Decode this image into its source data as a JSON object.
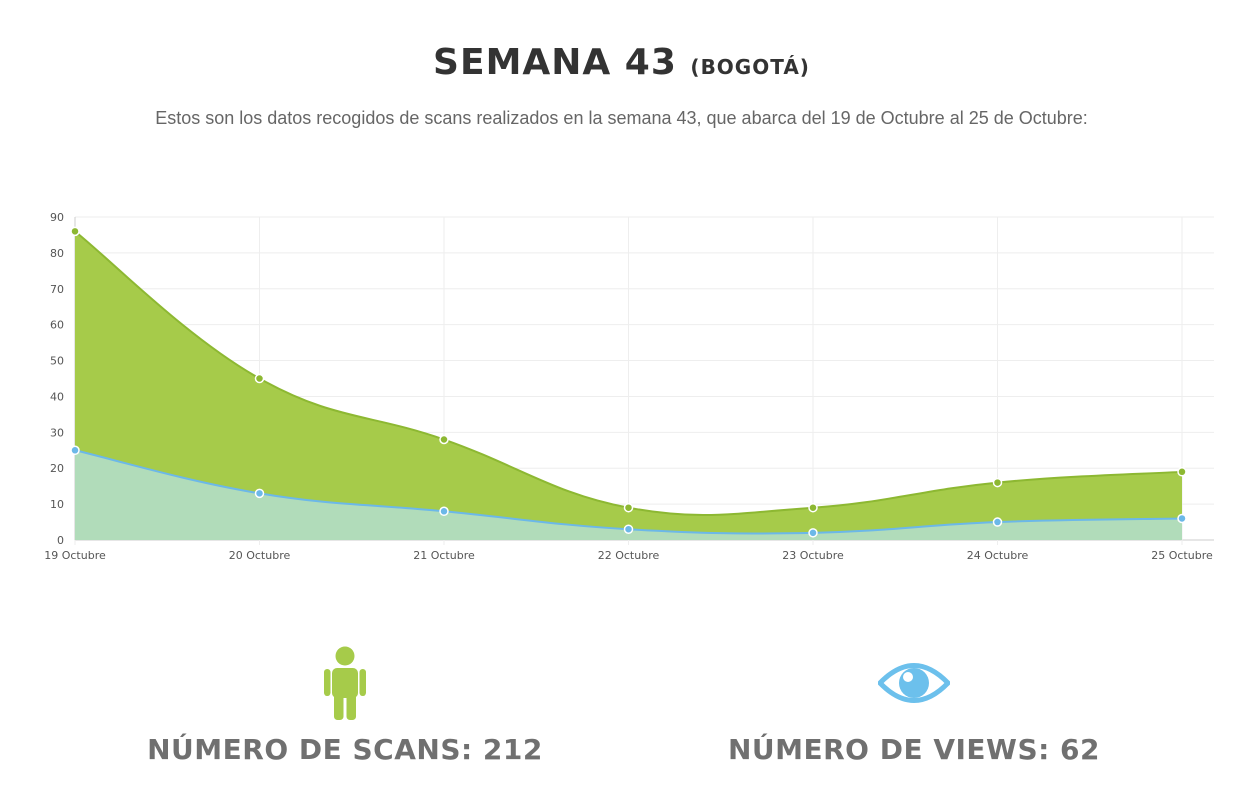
{
  "header": {
    "title_main": "SEMANA 43",
    "title_city": "(BOGOTÁ)",
    "subtitle": "Estos son los datos recogidos de scans realizados en la semana 43, que abarca del 19 de Octubre al 25 de Octubre:"
  },
  "colors": {
    "scans_fill": "#a6cb4a",
    "scans_line": "#8db832",
    "views_fill": "#b1dcba",
    "views_line": "#6cb8e8",
    "views_point": "#6cb8e8",
    "grid": "#eeeeee",
    "axis": "#cccccc"
  },
  "chart_data": {
    "type": "area",
    "categories": [
      "19 Octubre",
      "20 Octubre",
      "21 Octubre",
      "22 Octubre",
      "23 Octubre",
      "24 Octubre",
      "25 Octubre"
    ],
    "series": [
      {
        "values": [
          86,
          45,
          28,
          9,
          9,
          16,
          19
        ]
      },
      {
        "values": [
          25,
          13,
          8,
          3,
          2,
          5,
          6
        ]
      }
    ],
    "yticks": [
      0,
      10,
      20,
      30,
      40,
      50,
      60,
      70,
      80,
      90
    ],
    "ylim": [
      0,
      90
    ],
    "grid": true,
    "xlabel": "",
    "ylabel": ""
  },
  "stats": {
    "scans_icon": "person-icon",
    "scans_label": "NÚMERO DE SCANS: 212",
    "views_icon": "eye-icon",
    "views_label": "NÚMERO DE VIEWS: 62"
  }
}
